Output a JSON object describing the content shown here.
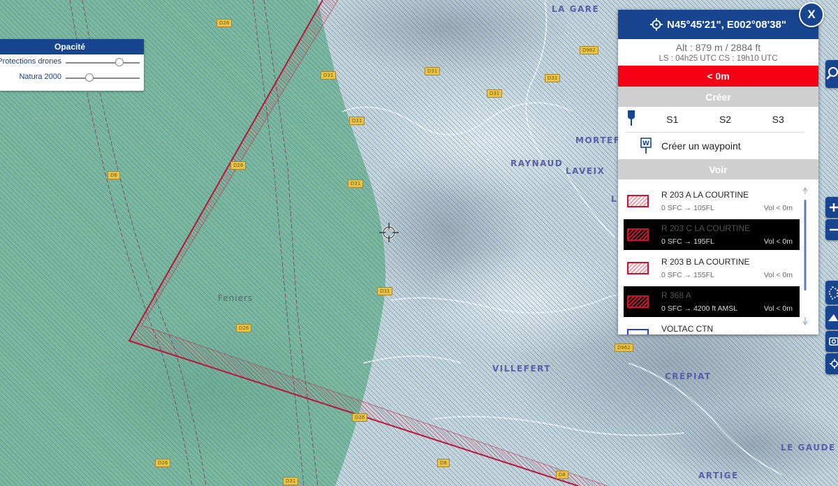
{
  "map": {
    "places": [
      {
        "name": "LA GARE"
      },
      {
        "name": "MORTEF"
      },
      {
        "name": "RAYNAUD"
      },
      {
        "name": "LAVEIX"
      },
      {
        "name": "L"
      },
      {
        "name": "VILLEFERT"
      },
      {
        "name": "CRÉPIAT"
      },
      {
        "name": "LE GAUDE"
      },
      {
        "name": "ARTIGE"
      },
      {
        "name": "Feniers"
      }
    ],
    "roads": [
      "D26",
      "D962",
      "D31",
      "D31",
      "D31",
      "D31",
      "D26",
      "D8",
      "D31",
      "D31",
      "D26",
      "D962",
      "D26",
      "D26",
      "D8",
      "D31",
      "D8"
    ],
    "colors": {
      "green_zone": "#5fae85",
      "red_boundary": "#b5173a",
      "blue_hatch": "#3c5fb0"
    }
  },
  "opacity_panel": {
    "title": "Opacité",
    "sliders": [
      {
        "label": "Protections drones",
        "value": 0.75
      },
      {
        "label": "Natura 2000",
        "value": 0.3
      }
    ]
  },
  "info_panel": {
    "coords": "N45°45'21\", E002°08'38\"",
    "altitude": "Alt : 879 m / 2884 ft",
    "sun_times": "LS : 04h25 UTC   CS : 19h10 UTC",
    "alert": "< 0m",
    "create_section": "Créer",
    "slots": [
      "S1",
      "S2",
      "S3"
    ],
    "create_waypoint": "Créer un waypoint",
    "see_section": "Voir",
    "zones": [
      {
        "name": "R 203 A LA COURTINE",
        "range": "0 SFC → 105FL",
        "vol": "Vol < 0m",
        "dark": false
      },
      {
        "name": "R 203 C LA COURTINE",
        "range": "0 SFC → 195FL",
        "vol": "Vol < 0m",
        "dark": true
      },
      {
        "name": "R 203 B LA COURTINE",
        "range": "0 SFC → 155FL",
        "vol": "Vol < 0m",
        "dark": false
      },
      {
        "name": "R 368 A",
        "range": "0 SFC → 4200 ft AMSL",
        "vol": "Vol < 0m",
        "dark": true
      },
      {
        "name": "VOLTAC CTN",
        "range": "",
        "vol": "",
        "dark": false
      }
    ],
    "close_label": "X"
  }
}
